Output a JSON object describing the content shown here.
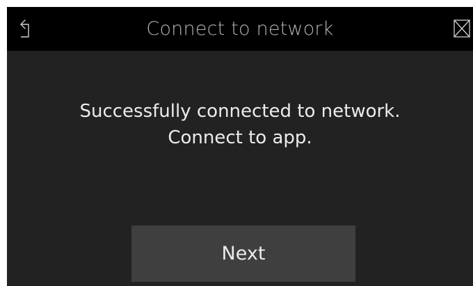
{
  "header": {
    "title": "Connect to network",
    "back_icon": "back-arrow-icon",
    "close_icon": "close-icon"
  },
  "main": {
    "message_line1": "Successfully connected to network.",
    "message_line2": "Connect to app.",
    "next_label": "Next"
  },
  "colors": {
    "header_bg": "#000000",
    "body_bg": "#222222",
    "button_bg": "#3f3f3f",
    "text": "#ececec",
    "title_text": "#b4b4b4"
  }
}
